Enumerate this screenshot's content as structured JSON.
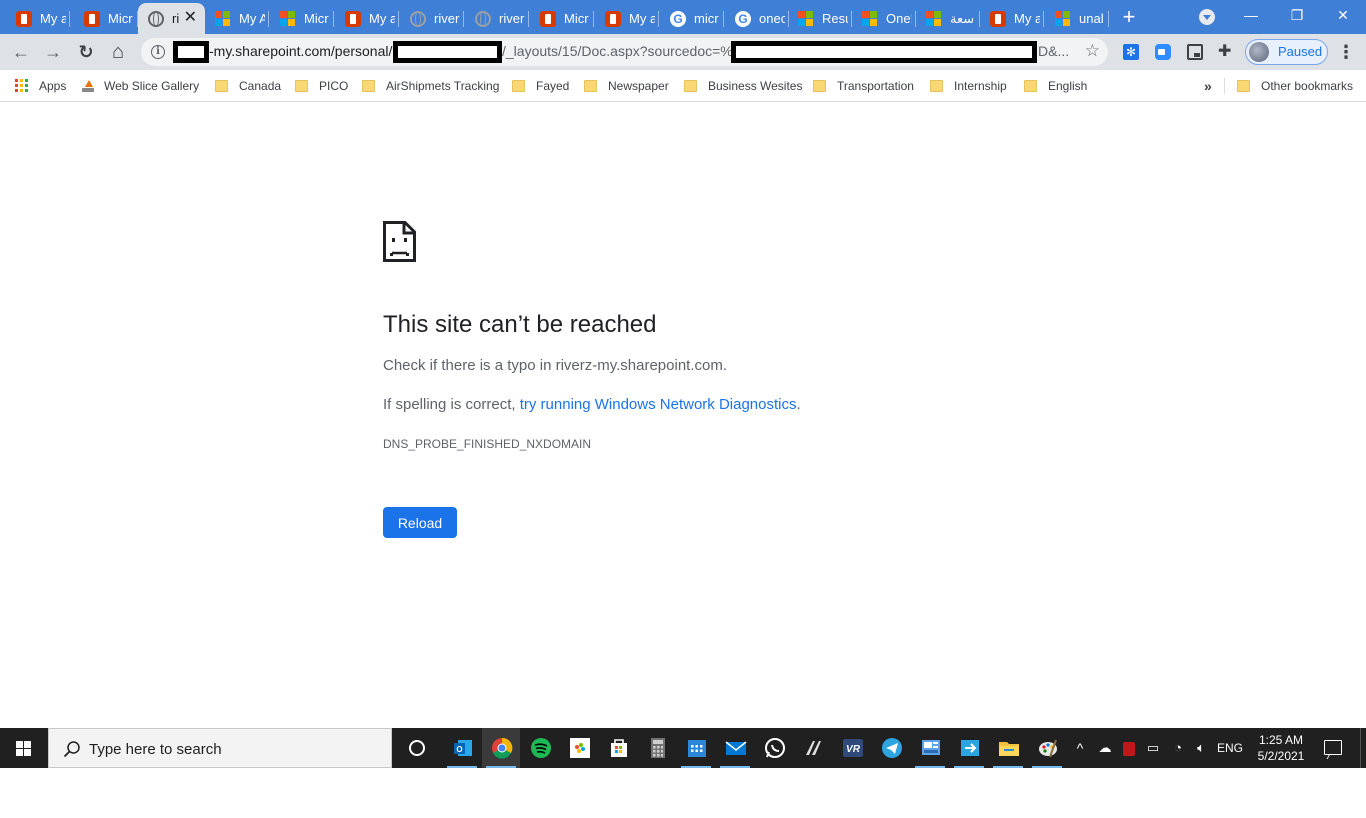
{
  "tabs": [
    {
      "title": "My a",
      "icon": "office-icon"
    },
    {
      "title": "Micr",
      "icon": "office-icon"
    },
    {
      "title": "ri",
      "icon": "globe-icon",
      "active": true
    },
    {
      "title": "My A",
      "icon": "microsoft-icon"
    },
    {
      "title": "Micr",
      "icon": "microsoft-icon"
    },
    {
      "title": "My a",
      "icon": "office-icon"
    },
    {
      "title": "river",
      "icon": "globe-icon"
    },
    {
      "title": "river",
      "icon": "globe-icon"
    },
    {
      "title": "Micr",
      "icon": "office-icon"
    },
    {
      "title": "My a",
      "icon": "office-icon"
    },
    {
      "title": "micr",
      "icon": "google-icon"
    },
    {
      "title": "onec",
      "icon": "google-icon"
    },
    {
      "title": "Resu",
      "icon": "microsoft-icon"
    },
    {
      "title": "One!",
      "icon": "microsoft-icon"
    },
    {
      "title": "سعة",
      "icon": "microsoft-icon"
    },
    {
      "title": "My a",
      "icon": "office-icon"
    },
    {
      "title": "unal",
      "icon": "microsoft-icon"
    }
  ],
  "window": {
    "minimize": "—",
    "restore": "❐",
    "close": "✕",
    "new_tab": "+"
  },
  "toolbar": {
    "back": "←",
    "forward": "→",
    "reload": "↻",
    "home": "⌂",
    "url_part1": "-my.sharepoint.com/personal/",
    "url_part2": "/_layouts/15/Doc.aspx?sourcedoc=%",
    "url_part3": "D&...",
    "star": "☆",
    "profile_status": "Paused",
    "menu": "⋮"
  },
  "bookmarks": {
    "apps": "Apps",
    "items": [
      "Web Slice Gallery",
      "Canada",
      "PICO",
      "AirShipmets Tracking",
      "Fayed",
      "Newspaper",
      "Business Wesites",
      "Transportation",
      "Internship",
      "English"
    ],
    "more": "»",
    "other": "Other bookmarks"
  },
  "error": {
    "title": "This site can’t be reached",
    "line1": "Check if there is a typo in riverz-my.sharepoint.com.",
    "line2_prefix": "If spelling is correct, ",
    "line2_link": "try running Windows Network Diagnostics",
    "line2_suffix": ".",
    "code": "DNS_PROBE_FINISHED_NXDOMAIN",
    "reload_label": "Reload"
  },
  "taskbar": {
    "search_placeholder": "Type here to search",
    "apps": [
      "cortana-icon",
      "outlook-icon",
      "chrome-icon",
      "spotify-icon",
      "photos-icon",
      "store-icon",
      "calculator-icon",
      "calendar-icon",
      "mail-icon",
      "whatsapp-icon",
      "nitro-icon",
      "vr-icon",
      "telegram-icon",
      "control-panel-icon",
      "snip-icon",
      "file-explorer-icon",
      "paint-icon"
    ],
    "tray": {
      "chevron": "^",
      "language": "ENG"
    },
    "time": "1:25 AM",
    "date": "5/2/2021"
  },
  "colors": {
    "tab_strip": "#3f7fd6",
    "toolbar": "#dee1e6",
    "link": "#1a73e8",
    "button": "#1a73e8",
    "taskbar": "#202020"
  }
}
